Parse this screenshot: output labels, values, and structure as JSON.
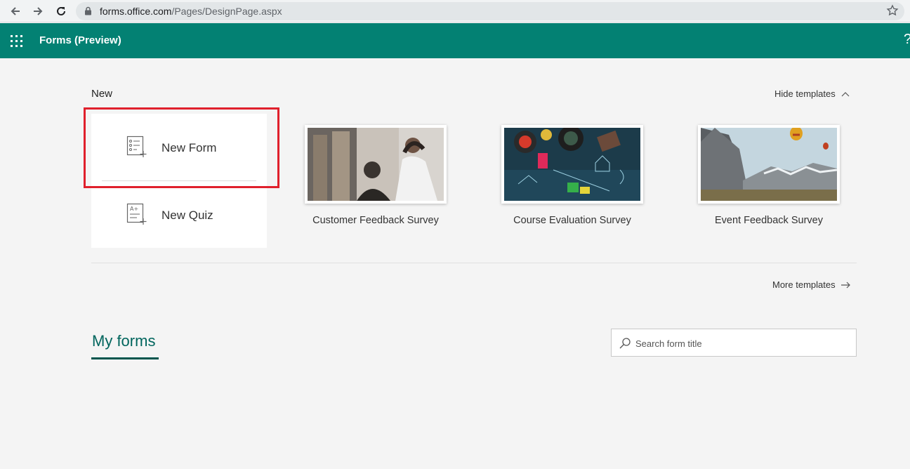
{
  "browser": {
    "url_domain": "forms.office.com",
    "url_path": "/Pages/DesignPage.aspx"
  },
  "header": {
    "title": "Forms (Preview)",
    "help": "?",
    "color": "#038173"
  },
  "new_section": {
    "heading": "New",
    "hide_templates": "Hide templates",
    "new_form": "New Form",
    "new_quiz": "New Quiz",
    "more_templates": "More templates"
  },
  "templates": [
    {
      "name": "Customer Feedback Survey"
    },
    {
      "name": "Course Evaluation Survey"
    },
    {
      "name": "Event Feedback Survey"
    }
  ],
  "my_forms": {
    "tab": "My forms",
    "search_placeholder": "Search form title"
  },
  "highlight_color": "#e0202c"
}
